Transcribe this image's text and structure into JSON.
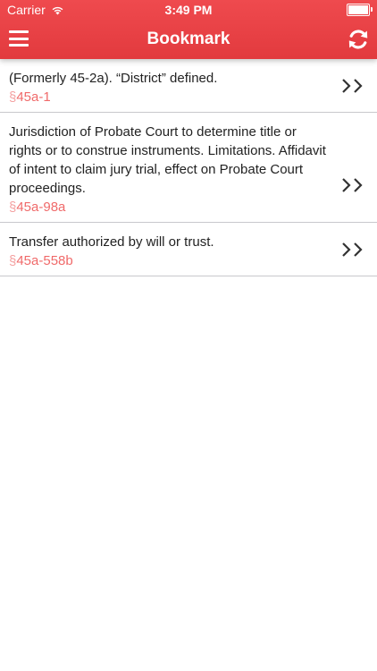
{
  "status_bar": {
    "carrier": "Carrier",
    "time": "3:49 PM"
  },
  "header": {
    "title": "Bookmark",
    "menu_icon": "hamburger-icon",
    "refresh_icon": "refresh-icon",
    "accent_color": "#e8403f"
  },
  "bookmarks": [
    {
      "title": "(Formerly 45-2a). “District” defined.",
      "section_symbol": "§",
      "section": "45a-1"
    },
    {
      "title": "Jurisdiction of Probate Court to determine title or rights or to construe instruments. Limitations. Affidavit of intent to claim jury trial, effect on Probate Court proceedings.",
      "section_symbol": "§",
      "section": "45a-98a"
    },
    {
      "title": "Transfer authorized by will or trust.",
      "section_symbol": "§",
      "section": "45a-558b"
    }
  ]
}
